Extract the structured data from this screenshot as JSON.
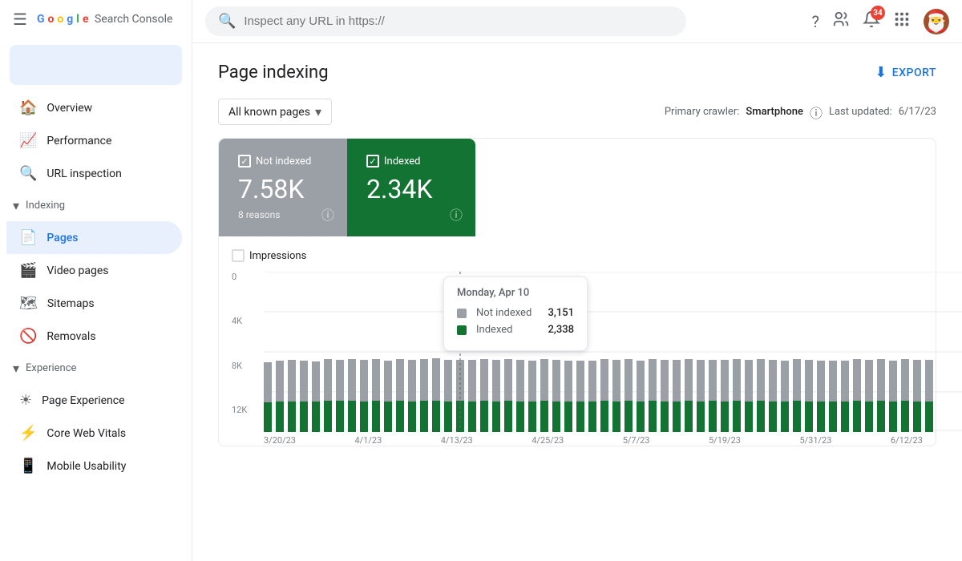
{
  "app": {
    "title": "Google Search Console",
    "search_placeholder": "Inspect any URL in https://"
  },
  "topbar_icons": {
    "help": "?",
    "accounts": "👥",
    "notifications": "🔔",
    "notification_count": "34",
    "apps": "⋮⋮",
    "avatar": "🎅"
  },
  "sidebar": {
    "property_selector": "",
    "nav_items": [
      {
        "id": "overview",
        "label": "Overview",
        "icon": "🏠",
        "active": false
      },
      {
        "id": "performance",
        "label": "Performance",
        "icon": "📈",
        "active": false
      },
      {
        "id": "url-inspection",
        "label": "URL inspection",
        "icon": "🔍",
        "active": false
      }
    ],
    "sections": [
      {
        "id": "indexing",
        "label": "Indexing",
        "expanded": true,
        "items": [
          {
            "id": "pages",
            "label": "Pages",
            "icon": "📄",
            "active": true
          },
          {
            "id": "video-pages",
            "label": "Video pages",
            "icon": "🎬",
            "active": false
          },
          {
            "id": "sitemaps",
            "label": "Sitemaps",
            "icon": "🗺",
            "active": false
          },
          {
            "id": "removals",
            "label": "Removals",
            "icon": "🚫",
            "active": false
          }
        ]
      },
      {
        "id": "experience",
        "label": "Experience",
        "expanded": true,
        "items": [
          {
            "id": "page-experience",
            "label": "Page Experience",
            "icon": "☀",
            "active": false
          },
          {
            "id": "core-web-vitals",
            "label": "Core Web Vitals",
            "icon": "⚡",
            "active": false
          },
          {
            "id": "mobile-usability",
            "label": "Mobile Usability",
            "icon": "📱",
            "active": false
          }
        ]
      }
    ]
  },
  "page": {
    "title": "Page indexing",
    "export_label": "EXPORT",
    "filter": {
      "label": "All known pages",
      "primary_crawler_label": "Primary crawler:",
      "primary_crawler_value": "Smartphone",
      "last_updated_label": "Last updated:",
      "last_updated_value": "6/17/23"
    },
    "stat_not_indexed": {
      "label": "Not indexed",
      "value": "7.58K",
      "sub": "8 reasons"
    },
    "stat_indexed": {
      "label": "Indexed",
      "value": "2.34K",
      "sub": ""
    },
    "chart": {
      "legend": [
        {
          "label": "Impressions"
        }
      ],
      "tooltip": {
        "date": "Monday, Apr 10",
        "rows": [
          {
            "label": "Not indexed",
            "value": "3,151",
            "color": "#9aa0a6"
          },
          {
            "label": "Indexed",
            "value": "2,338",
            "color": "#137333"
          }
        ]
      },
      "y_labels": [
        "0",
        "4K",
        "8K",
        "12K"
      ],
      "x_labels": [
        "3/20/23",
        "4/1/23",
        "4/13/23",
        "4/25/23",
        "5/7/23",
        "5/19/23",
        "5/31/23",
        "6/12/23"
      ]
    }
  }
}
